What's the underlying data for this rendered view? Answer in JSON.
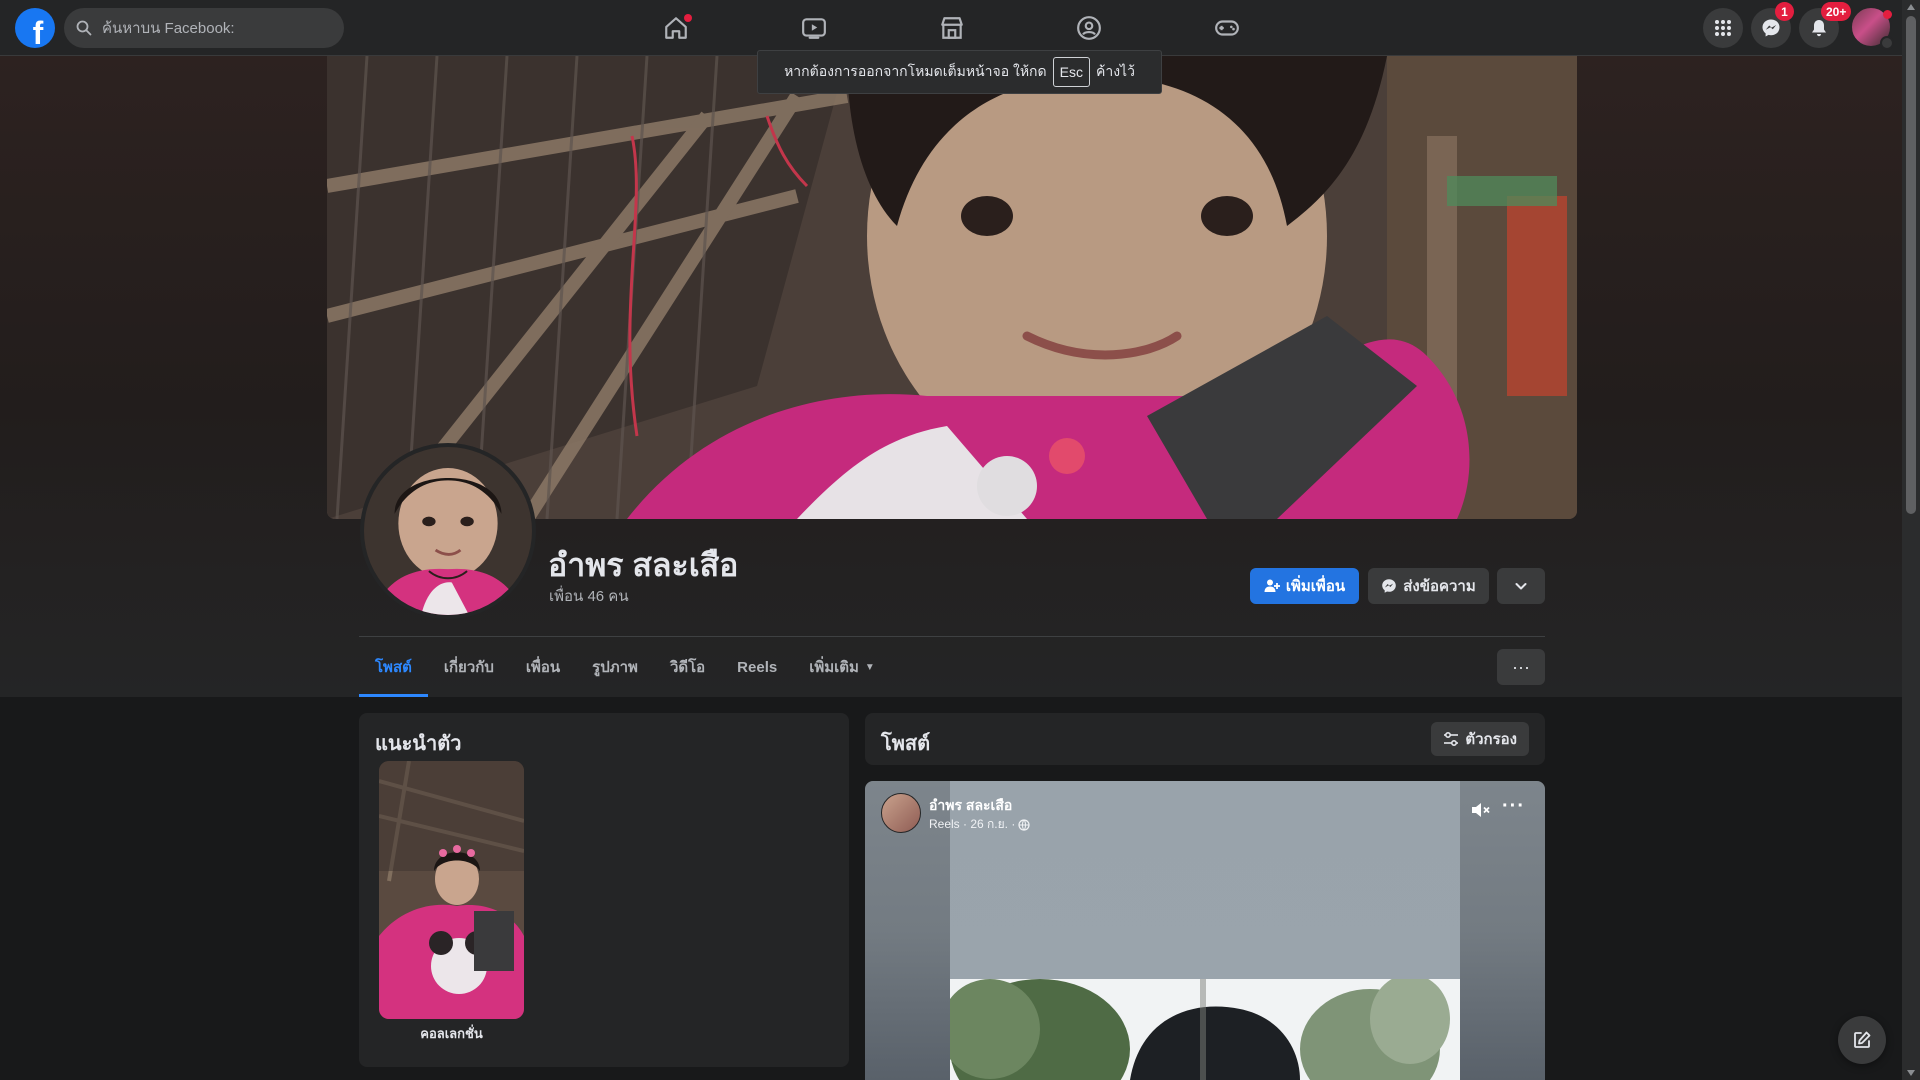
{
  "topbar": {
    "logo_letter": "f",
    "search_placeholder": "ค้นหาบน Facebook:",
    "messenger_badge": "1",
    "notifications_badge": "20+"
  },
  "fullscreen_toast": {
    "prefix": "หากต้องการออกจากโหมดเต็มหน้าจอ ให้กด",
    "key": "Esc",
    "suffix": "ค้างไว้"
  },
  "profile": {
    "name": "อำพร สละเสือ",
    "friends": "เพื่อน 46 คน",
    "add_friend_label": "เพิ่มเพื่อน",
    "message_label": "ส่งข้อความ"
  },
  "tabs": [
    {
      "label": "โพสต์",
      "active": true
    },
    {
      "label": "เกี่ยวกับ",
      "active": false
    },
    {
      "label": "เพื่อน",
      "active": false
    },
    {
      "label": "รูปภาพ",
      "active": false
    },
    {
      "label": "วิดีโอ",
      "active": false
    },
    {
      "label": "Reels",
      "active": false
    },
    {
      "label": "เพิ่มเติม",
      "active": false
    }
  ],
  "intro": {
    "title": "แนะนำตัว",
    "featured_label": "คอลเลกชั่น"
  },
  "posts": {
    "title": "โพสต์",
    "filter_label": "ตัวกรอง"
  },
  "post": {
    "author": "อำพร สละเสือ",
    "meta": "Reels · 26 ก.ย. ·"
  },
  "colors": {
    "accent": "#2d88ff",
    "primary_button": "#2374e1",
    "background": "#18191a",
    "card": "#242526",
    "badge": "#e41e3f"
  }
}
